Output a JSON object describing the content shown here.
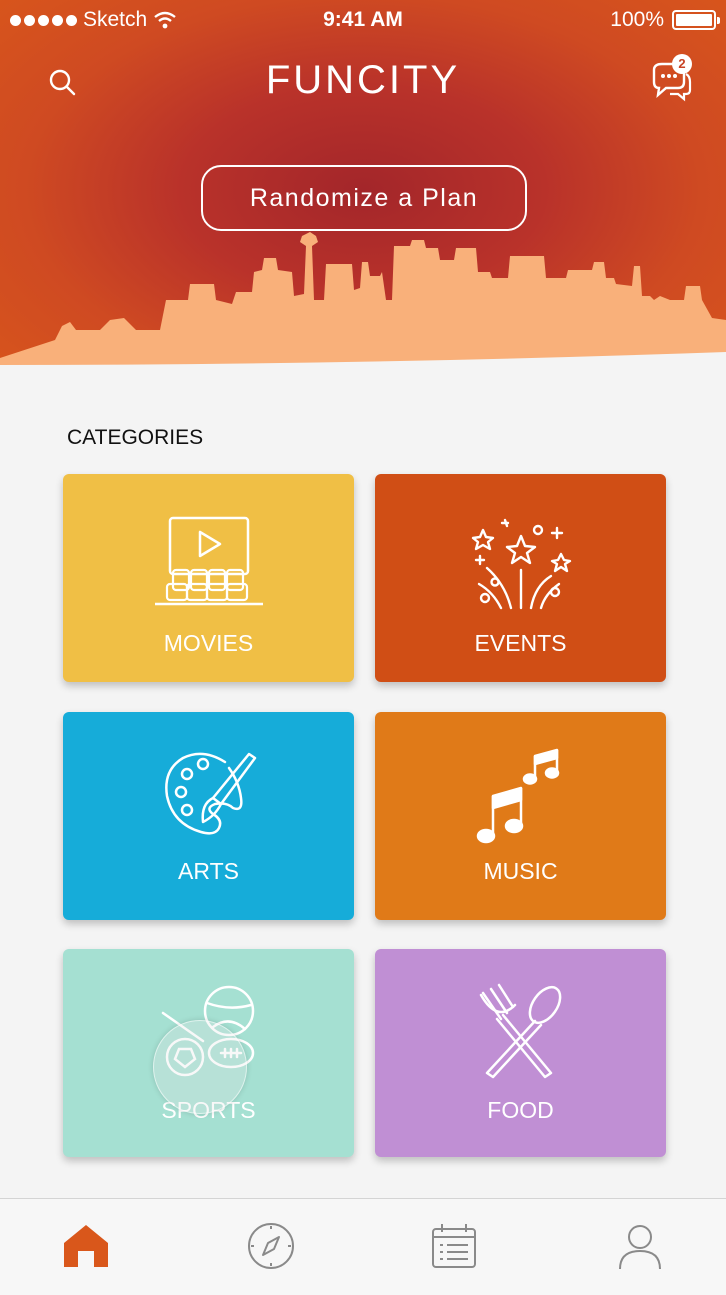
{
  "status_bar": {
    "carrier": "Sketch",
    "time": "9:41 AM",
    "battery": "100%"
  },
  "header": {
    "title": "FUNCITY",
    "search_icon": "search-icon",
    "chat_icon": "chat-bubbles-icon",
    "chat_badge": "2"
  },
  "hero": {
    "randomize_label": "Randomize a Plan"
  },
  "categories": {
    "heading": "CATEGORIES",
    "items": [
      {
        "label": "MOVIES",
        "icon": "movie-theater-icon",
        "color": "#f0bf45"
      },
      {
        "label": "EVENTS",
        "icon": "fireworks-icon",
        "color": "#d04e15"
      },
      {
        "label": "ARTS",
        "icon": "palette-brush-icon",
        "color": "#16acd9"
      },
      {
        "label": "MUSIC",
        "icon": "music-notes-icon",
        "color": "#e07a18"
      },
      {
        "label": "SPORTS",
        "icon": "sports-balls-icon",
        "color": "#a5e0d2"
      },
      {
        "label": "FOOD",
        "icon": "fork-spoon-icon",
        "color": "#c08fd4"
      }
    ]
  },
  "tab_bar": {
    "items": [
      {
        "name": "home",
        "icon": "home-icon",
        "active": true
      },
      {
        "name": "explore",
        "icon": "compass-icon",
        "active": false
      },
      {
        "name": "calendar",
        "icon": "calendar-list-icon",
        "active": false
      },
      {
        "name": "profile",
        "icon": "user-icon",
        "active": false
      }
    ]
  },
  "colors": {
    "accent": "#d9571b",
    "hero_dark": "#a3262a",
    "skyline": "#f9b07a",
    "background": "#f4f4f4"
  }
}
